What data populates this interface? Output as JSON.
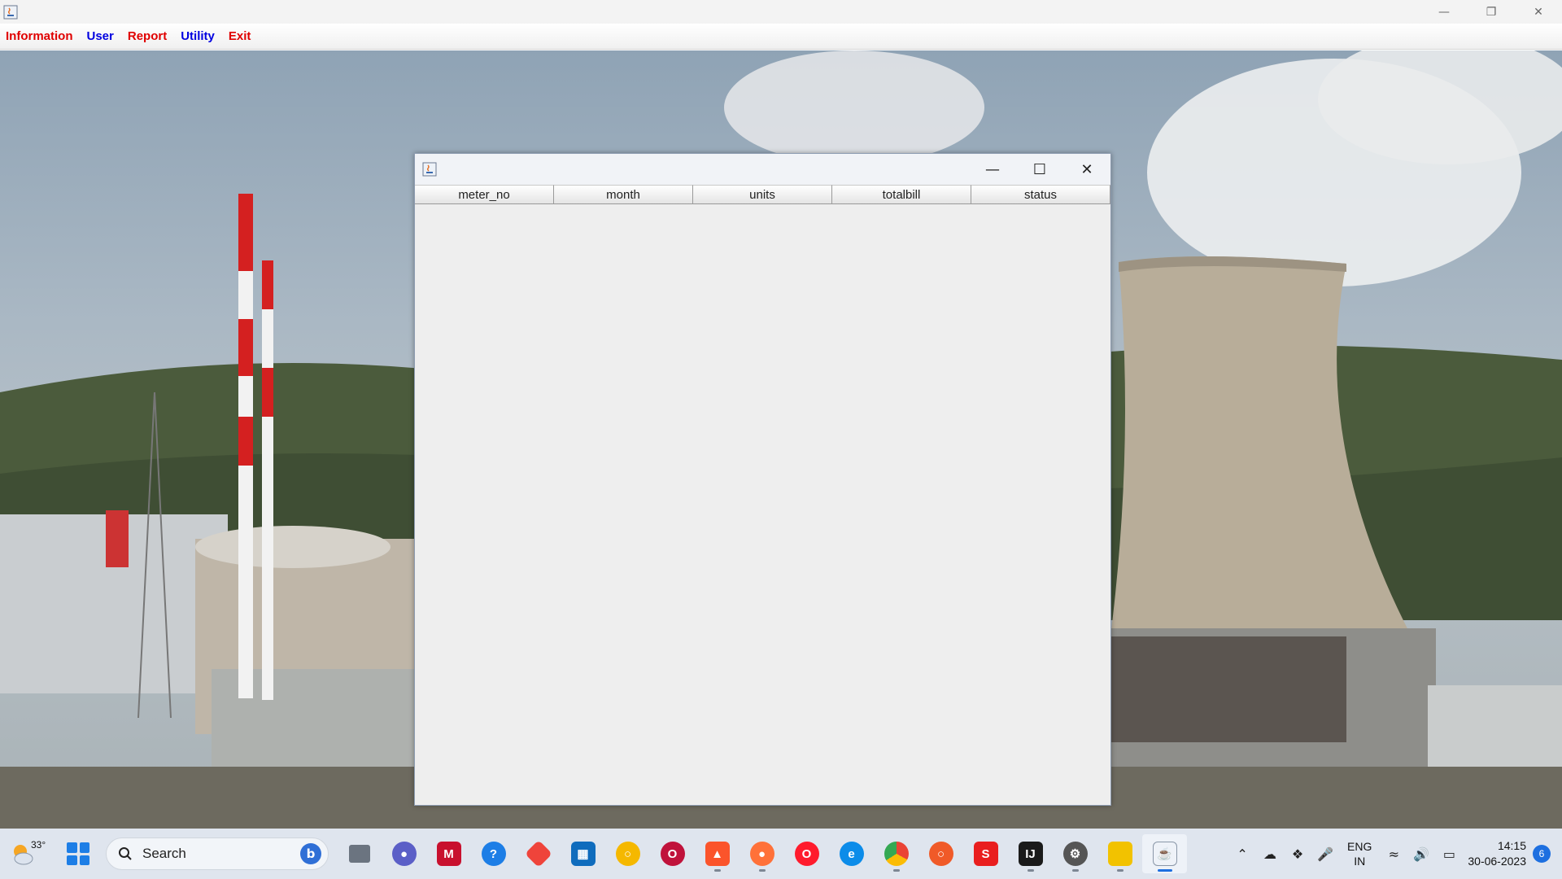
{
  "window": {
    "controls": [
      "minimize",
      "restore",
      "close"
    ]
  },
  "menubar": {
    "items": [
      {
        "label": "Information",
        "color": "#e00000"
      },
      {
        "label": "User",
        "color": "#0000e0"
      },
      {
        "label": "Report",
        "color": "#e00000"
      },
      {
        "label": "Utility",
        "color": "#0000e0"
      },
      {
        "label": "Exit",
        "color": "#e00000"
      }
    ]
  },
  "inner_frame": {
    "controls": [
      "minimize",
      "maximize",
      "close"
    ],
    "table": {
      "columns": [
        "meter_no",
        "month",
        "units",
        "totalbill",
        "status"
      ],
      "rows": []
    }
  },
  "taskbar": {
    "weather_temp": "33°",
    "search_label": "Search",
    "apps": [
      {
        "name": "bing-icon"
      },
      {
        "name": "task-view-icon"
      },
      {
        "name": "meet-icon",
        "color": "#5b5fc7"
      },
      {
        "name": "mcafee-icon",
        "color": "#c8102e"
      },
      {
        "name": "help-icon",
        "color": "#1d7ee6"
      },
      {
        "name": "anydesk-icon",
        "color": "#ef443b"
      },
      {
        "name": "store-icon",
        "color": "#0f6cbd"
      },
      {
        "name": "circle-app-icon",
        "color": "#f5b800"
      },
      {
        "name": "opera-gx-icon",
        "color": "#c0123b"
      },
      {
        "name": "brave-icon",
        "color": "#fb542b"
      },
      {
        "name": "firefox-icon",
        "color": "#ff7139"
      },
      {
        "name": "opera-icon",
        "color": "#ff1b2d"
      },
      {
        "name": "edge-icon",
        "color": "#0c8ce9"
      },
      {
        "name": "chrome-icon",
        "color": "#34a853"
      },
      {
        "name": "eclipse-icon",
        "color": "#f05a28"
      },
      {
        "name": "sublime-icon",
        "color": "#e91e1e"
      },
      {
        "name": "intellij-icon",
        "color": "#1a1a1a"
      },
      {
        "name": "settings-icon",
        "color": "#555555"
      },
      {
        "name": "file-explorer-icon",
        "color": "#f2c200"
      },
      {
        "name": "java-app-icon",
        "color": "#e66b1c"
      }
    ],
    "tray": {
      "lang_line1": "ENG",
      "lang_line2": "IN",
      "time": "14:15",
      "date": "30-06-2023",
      "notification_count": "6"
    }
  }
}
